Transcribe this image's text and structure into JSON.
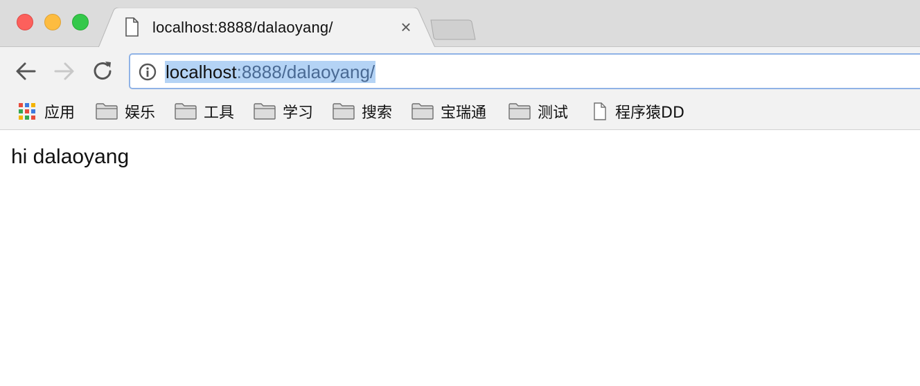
{
  "tab": {
    "title": "localhost:8888/dalaoyang/",
    "close_glyph": "×",
    "icon": "document-icon"
  },
  "toolbar": {
    "back_icon": "arrow-left-icon",
    "forward_icon": "arrow-right-icon",
    "reload_icon": "reload-icon"
  },
  "address_bar": {
    "host": "localhost",
    "rest": ":8888/dalaoyang/",
    "selected": true,
    "icon": "info-icon"
  },
  "bookmarks": [
    {
      "label": "应用",
      "icon": "apps-grid-icon"
    },
    {
      "label": "娱乐",
      "icon": "folder-icon"
    },
    {
      "label": "工具",
      "icon": "folder-icon"
    },
    {
      "label": "学习",
      "icon": "folder-icon"
    },
    {
      "label": "搜索",
      "icon": "folder-icon"
    },
    {
      "label": "宝瑞通",
      "icon": "folder-icon"
    },
    {
      "label": "测试",
      "icon": "folder-icon"
    },
    {
      "label": "程序猿DD",
      "icon": "page-icon"
    }
  ],
  "page": {
    "body_text": "hi dalaoyang"
  },
  "colors": {
    "close": "#fc605c",
    "minimize": "#fdbc40",
    "maximize": "#34c84a",
    "selection": "#b4d3f5",
    "omnibox_border": "#8fb2e6"
  }
}
